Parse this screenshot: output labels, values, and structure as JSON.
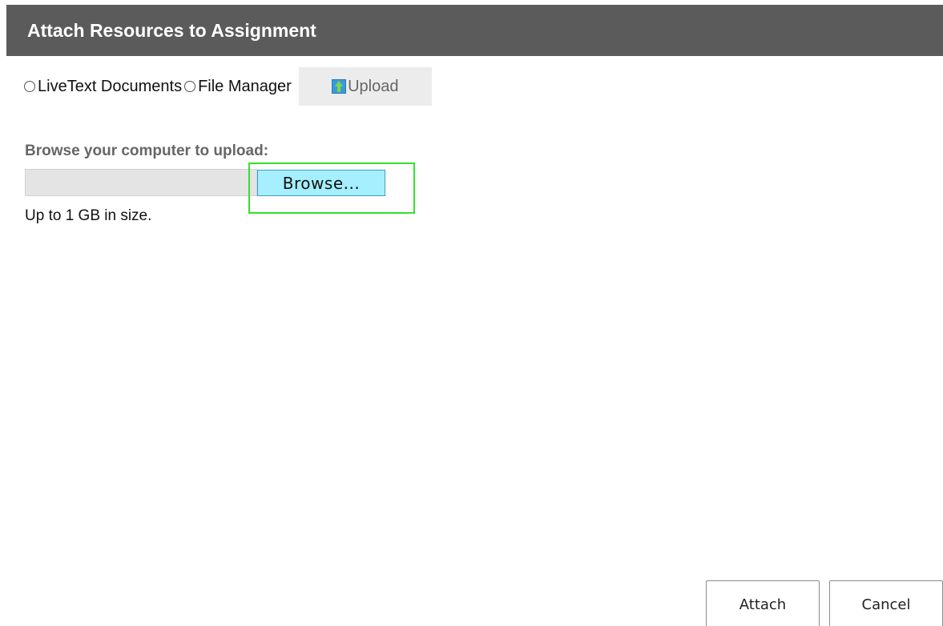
{
  "dialog": {
    "title": "Attach Resources to Assignment"
  },
  "source_options": {
    "livetext_label": "LiveText Documents",
    "file_manager_label": "File Manager",
    "upload_label": "Upload",
    "upload_icon": "upload-arrow-icon"
  },
  "upload_panel": {
    "heading": "Browse your computer to upload:",
    "file_value": "",
    "browse_label": "Browse...",
    "size_note": "Up to 1 GB in size."
  },
  "footer": {
    "attach_label": "Attach",
    "cancel_label": "Cancel"
  },
  "colors": {
    "header_bg": "#5b5b5b",
    "browse_bg": "#a6effe",
    "highlight": "#35e02c"
  }
}
